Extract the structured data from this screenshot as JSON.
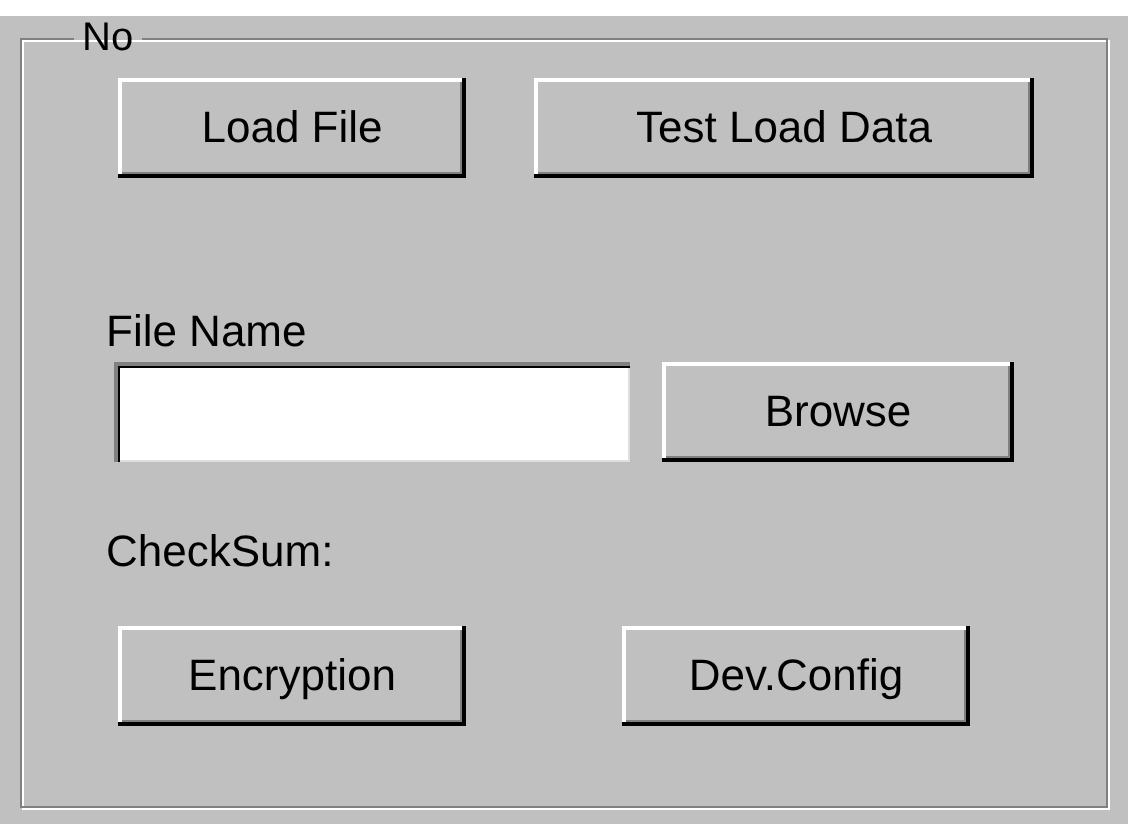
{
  "group": {
    "title": "No"
  },
  "top_buttons": [
    "Load File",
    "Test Load Data"
  ],
  "file_name": {
    "label": "File Name",
    "browse": "Browse"
  },
  "checksum_label": "CheckSum:",
  "bottom_buttons": [
    "Encryption",
    "Dev.Config"
  ]
}
